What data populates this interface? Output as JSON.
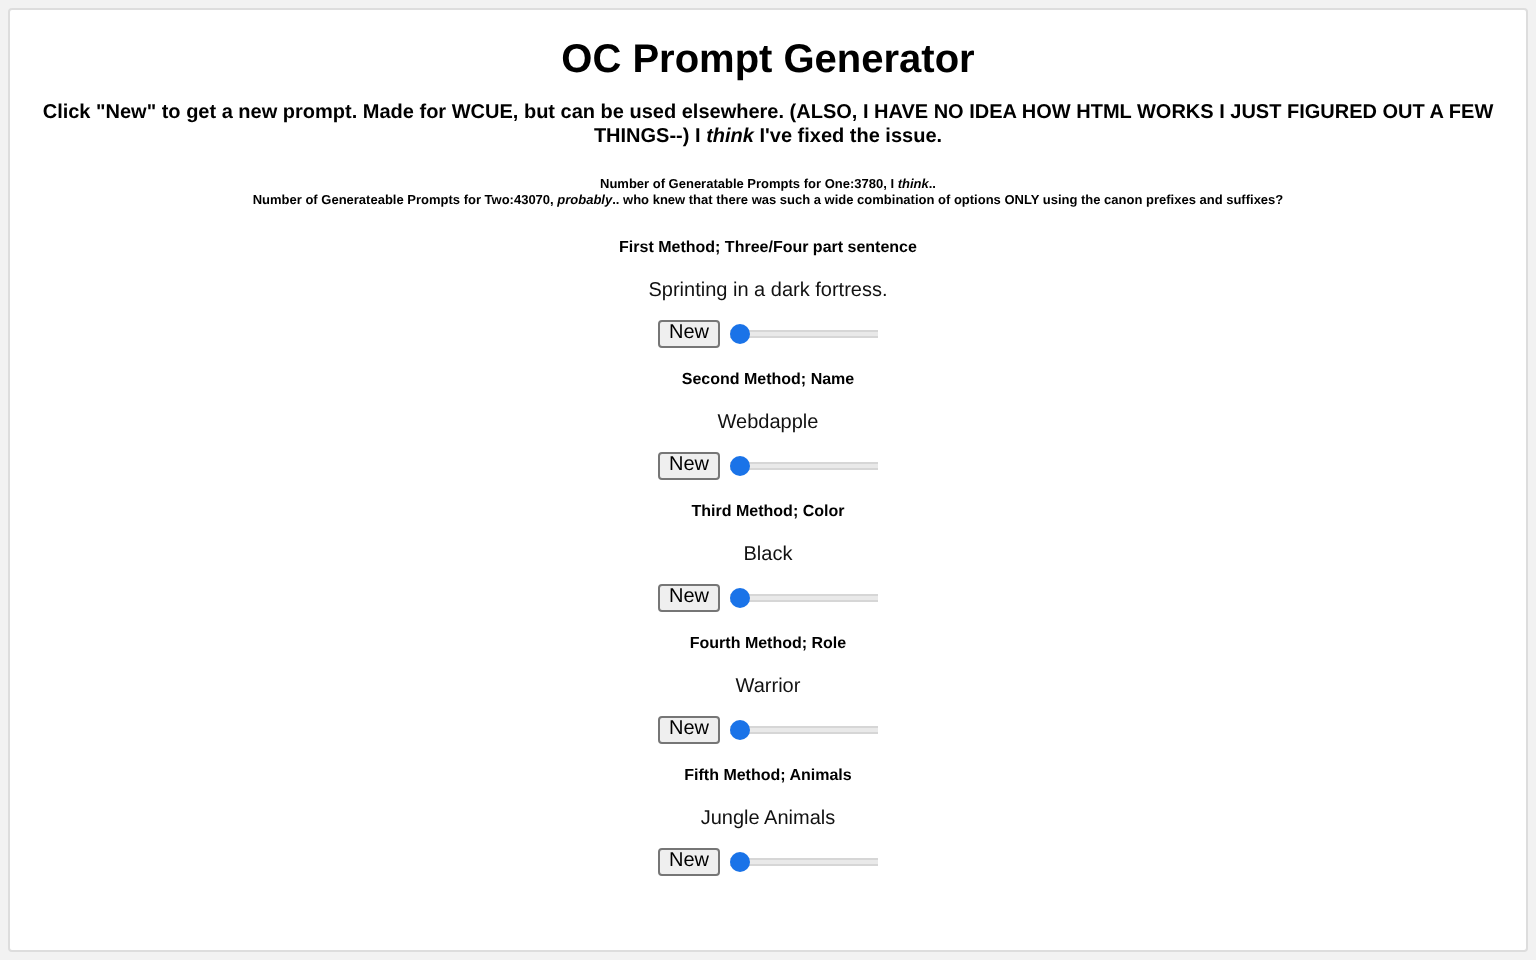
{
  "title": "OC Prompt Generator",
  "intro": "Click \"New\" to get a new prompt. Made for WCUE, but can be used elsewhere. (ALSO, I HAVE NO IDEA HOW HTML WORKS I JUST FIGURED OUT A FEW THINGS--) I *think* I've fixed the issue.",
  "counts": [
    "Number of Generatable Prompts for One:3780, I *think*..",
    "Number of Generateable Prompts for Two:43070, *probably*.. who knew that there was such a wide combination of options ONLY using the canon prefixes and suffixes?"
  ],
  "methods": [
    {
      "heading": "First Method; Three/Four part sentence",
      "result": "Sprinting in a dark fortress.",
      "button": "New",
      "level": 0
    },
    {
      "heading": "Second Method; Name",
      "result": "Webdapple",
      "button": "New",
      "level": 0
    },
    {
      "heading": "Third Method; Color",
      "result": "Black",
      "button": "New",
      "level": 0
    },
    {
      "heading": "Fourth Method; Role",
      "result": "Warrior",
      "button": "New",
      "level": 0
    },
    {
      "heading": "Fifth Method; Animals",
      "result": "Jungle Animals",
      "button": "New",
      "level": 0
    }
  ]
}
